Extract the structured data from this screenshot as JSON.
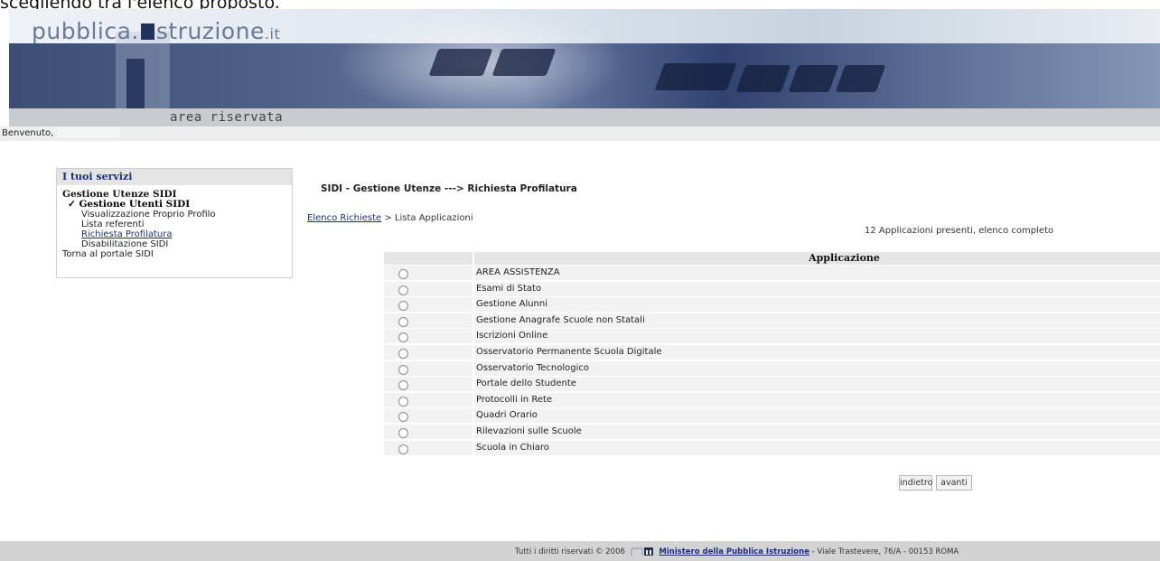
{
  "page": {
    "top_caption": "scegliendo tra l'elenco proposto."
  },
  "header": {
    "logo_left": "pubblica.",
    "logo_right": "struzione",
    "logo_tld": ".it",
    "area_label": "area riservata",
    "welcome": "Benvenuto,"
  },
  "sidebar": {
    "title": "I tuoi servizi",
    "group": "Gestione Utenze SIDI",
    "current_check": "✓",
    "current": "Gestione Utenti SIDI",
    "items": [
      {
        "label": "Visualizzazione Proprio Profilo"
      },
      {
        "label": "Lista referenti"
      },
      {
        "label": "Richiesta Profilatura"
      },
      {
        "label": "Disabilitazione SIDI"
      }
    ],
    "back_link": "Torna al portale SIDI"
  },
  "main": {
    "title": "SIDI - Gestione Utenze ---> Richiesta Profilatura",
    "breadcrumb_link": "Elenco Richieste",
    "breadcrumb_rest": " > Lista Applicazioni",
    "count_text": "12 Applicazioni presenti, elenco completo",
    "column_header": "Applicazione",
    "applications": [
      {
        "name": "AREA ASSISTENZA"
      },
      {
        "name": "Esami di Stato"
      },
      {
        "name": "Gestione Alunni"
      },
      {
        "name": "Gestione Anagrafe Scuole non Statali"
      },
      {
        "name": "Iscrizioni Online"
      },
      {
        "name": "Osservatorio Permanente Scuola Digitale"
      },
      {
        "name": "Osservatorio Tecnologico"
      },
      {
        "name": "Portale dello Studente"
      },
      {
        "name": "Protocolli in Rete"
      },
      {
        "name": "Quadri Orario"
      },
      {
        "name": "Rilevazioni sulle Scuole"
      },
      {
        "name": "Scuola in Chiaro"
      }
    ],
    "back_button": "indietro",
    "next_button": "avanti"
  },
  "footer": {
    "rights": "Tutti i diritti riservati © 2006",
    "ministry": "Ministero della Pubblica Istruzione",
    "address": "- Viale Trastevere, 76/A - 00153 ROMA"
  },
  "colors": {
    "link": "#1a2f7a",
    "banner_dark": "#23325a"
  }
}
